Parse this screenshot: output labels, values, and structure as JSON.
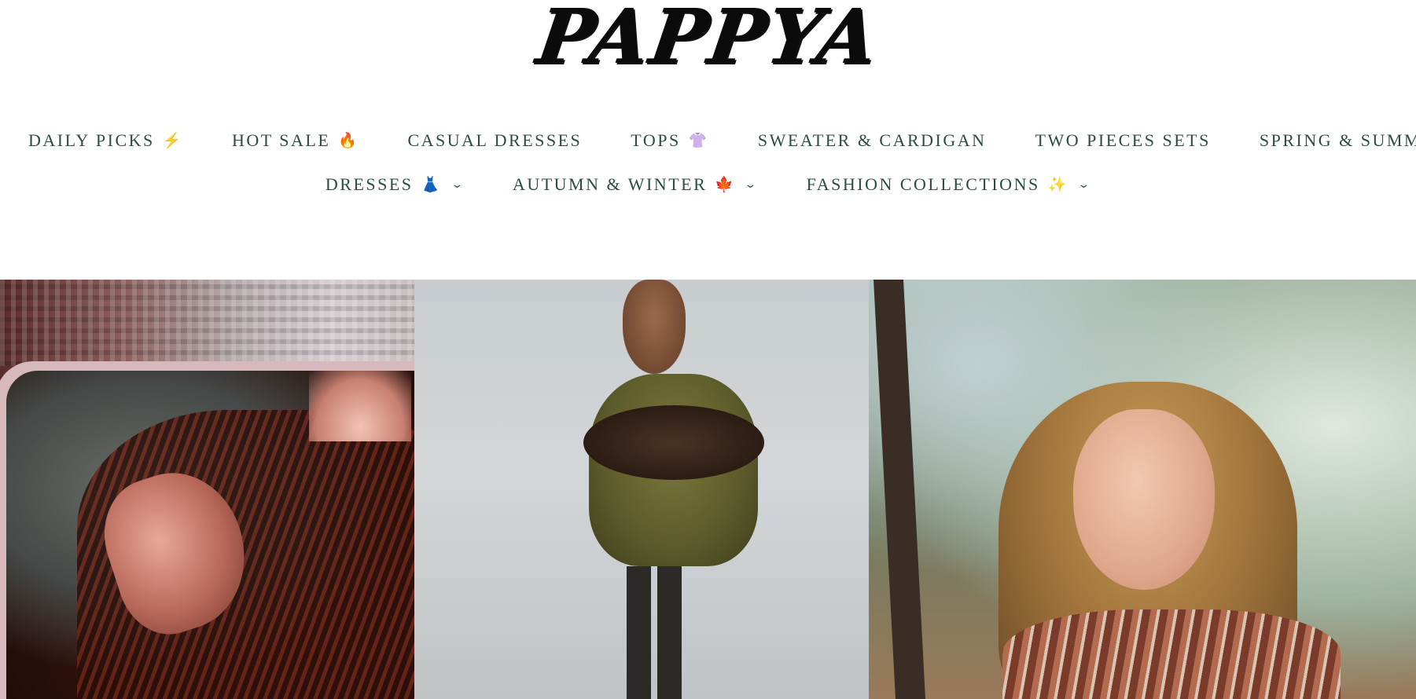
{
  "logo": {
    "text": "PAPPYA"
  },
  "nav": {
    "row1": [
      {
        "label": "DAILY PICKS",
        "emoji": "⚡"
      },
      {
        "label": "HOT SALE",
        "emoji": "🔥"
      },
      {
        "label": "CASUAL DRESSES",
        "emoji": ""
      },
      {
        "label": "TOPS",
        "emoji": "👚"
      },
      {
        "label": "SWEATER & CARDIGAN",
        "emoji": ""
      },
      {
        "label": "TWO PIECES SETS",
        "emoji": ""
      },
      {
        "label": "SPRING & SUMMER",
        "emoji": "🥰"
      }
    ],
    "row2": [
      {
        "label": "DRESSES",
        "emoji": "👗",
        "chevron": "⌄"
      },
      {
        "label": "AUTUMN & WINTER",
        "emoji": "🍁",
        "chevron": "⌄"
      },
      {
        "label": "FASHION COLLECTIONS",
        "emoji": "✨",
        "chevron": "⌄"
      }
    ]
  },
  "colors": {
    "nav_text": "#2b4d40",
    "logo": "#0b0b0b",
    "background": "#ffffff"
  }
}
